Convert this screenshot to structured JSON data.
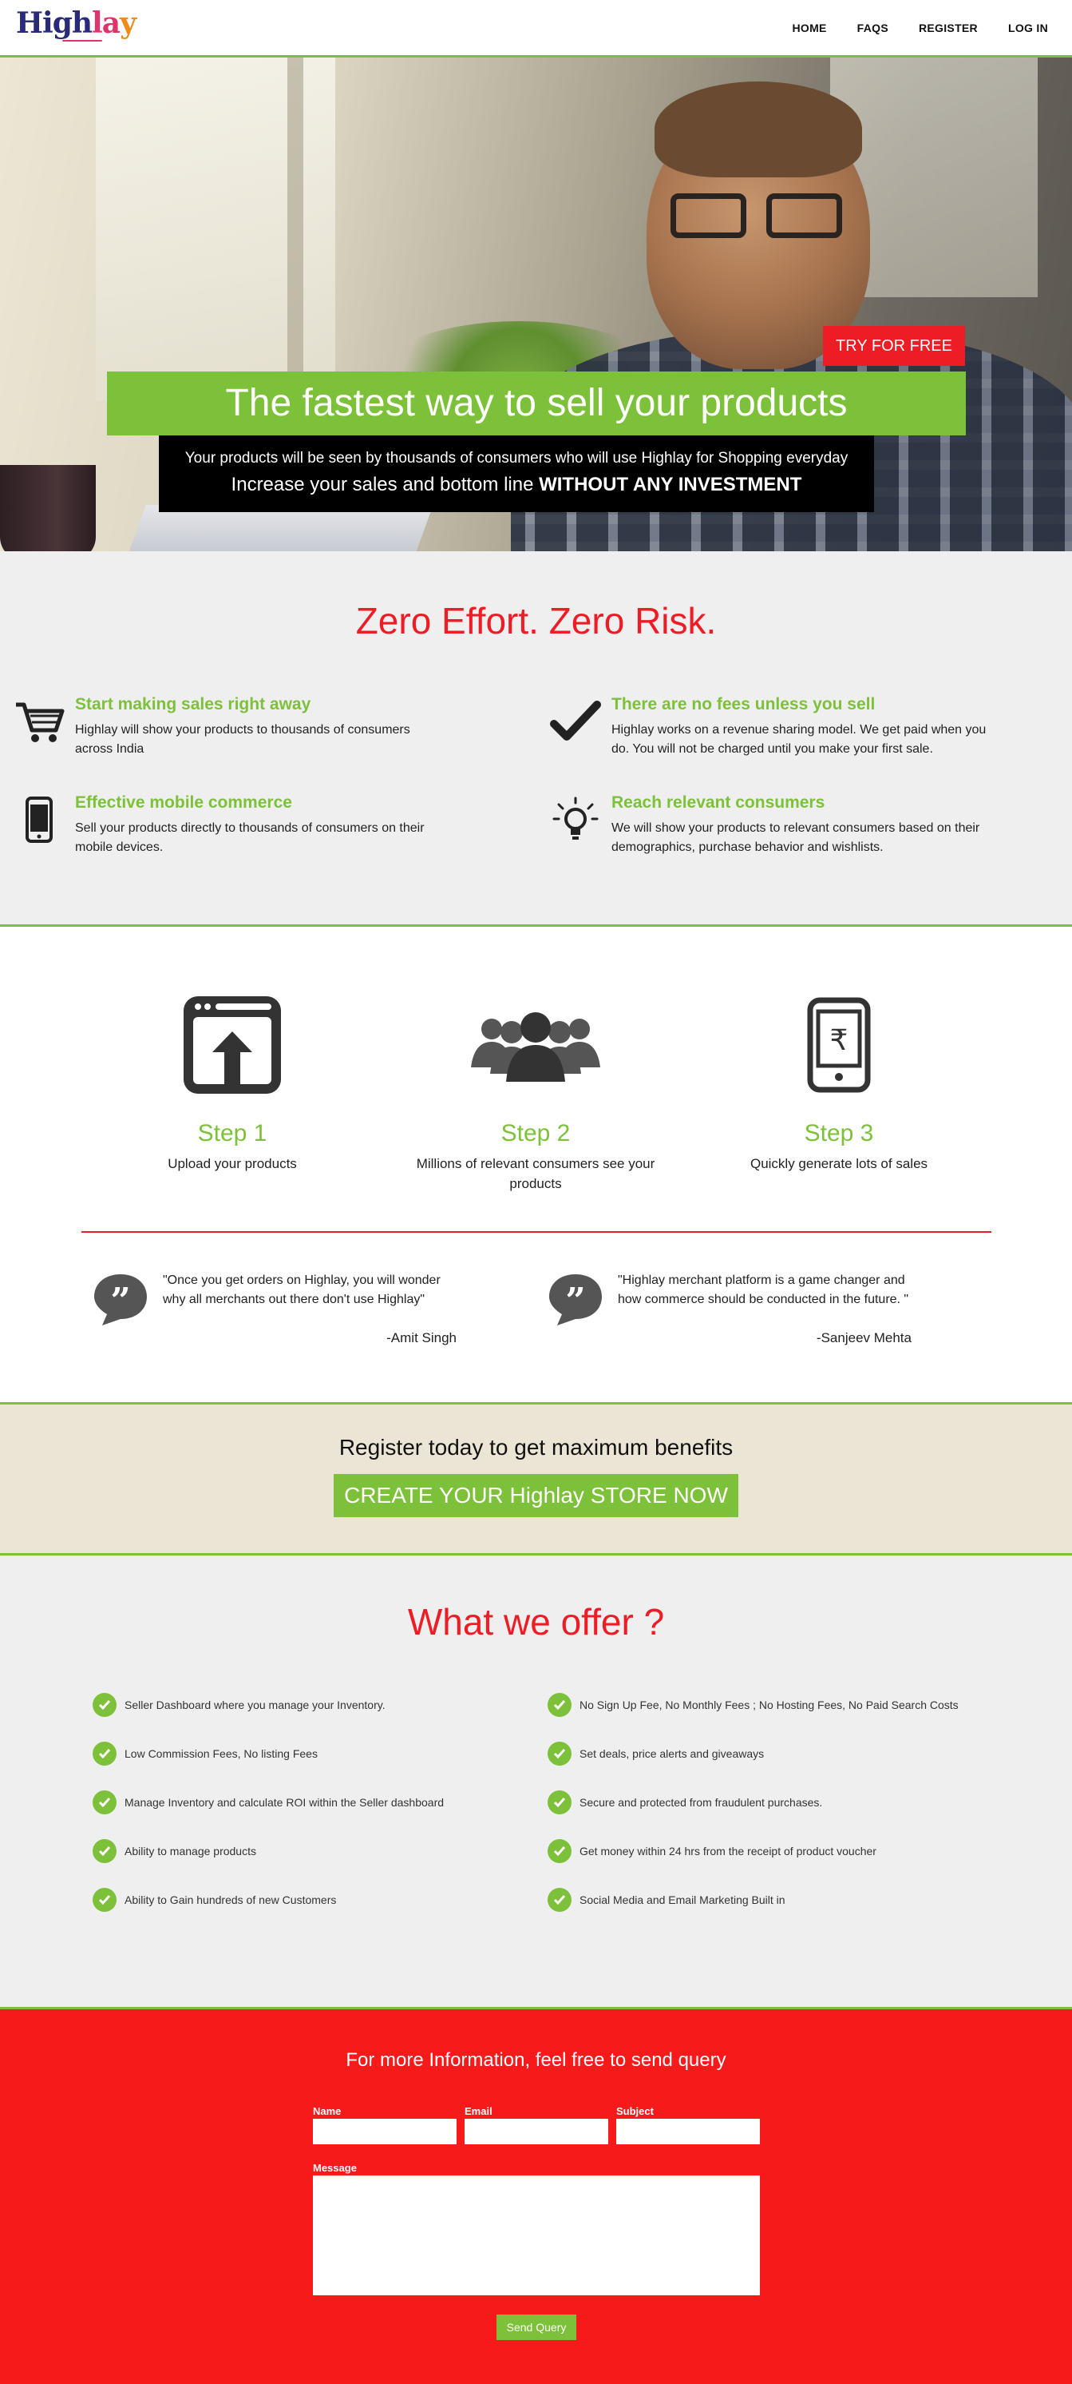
{
  "nav": {
    "logo_part1": "High",
    "logo_part2": "la",
    "logo_part3": "y",
    "items": [
      {
        "label": "HOME"
      },
      {
        "label": "FAQS"
      },
      {
        "label": "REGISTER"
      },
      {
        "label": "LOG IN"
      }
    ]
  },
  "hero": {
    "try_button": "TRY FOR FREE",
    "headline": "The fastest way to sell your products",
    "sub1": "Your products will be seen by thousands of consumers who will use Highlay for Shopping everyday",
    "sub2_prefix": "Increase your sales and bottom line ",
    "sub2_bold": "WITHOUT ANY INVESTMENT"
  },
  "zero": {
    "title": "Zero Effort. Zero Risk.",
    "features": [
      {
        "icon": "cart-icon",
        "title": "Start making sales right away",
        "text": "Highlay will show your products to thousands of consumers across India"
      },
      {
        "icon": "checkmark-icon",
        "title": "There are no fees unless you sell",
        "text": "Highlay works on a revenue sharing model. We get paid when you do. You will not be charged until you make your first sale."
      },
      {
        "icon": "mobile-icon",
        "title": "Effective mobile commerce",
        "text": "Sell your products directly to thousands of consumers on their mobile devices."
      },
      {
        "icon": "lightbulb-icon",
        "title": "Reach relevant consumers",
        "text": "We will show your products to relevant consumers based on their demographics, purchase behavior and wishlists."
      }
    ]
  },
  "steps": [
    {
      "icon": "upload-icon",
      "title": "Step 1",
      "text": "Upload your products"
    },
    {
      "icon": "people-icon",
      "title": "Step 2",
      "text": "Millions of relevant consumers see your products"
    },
    {
      "icon": "rupee-phone-icon",
      "title": "Step 3",
      "text": "Quickly generate lots of sales"
    }
  ],
  "quotes": [
    {
      "text": "\"Once you get orders on Highlay, you will wonder why all merchants out there don't use Highlay\"",
      "author": "-Amit Singh"
    },
    {
      "text": "\"Highlay merchant platform is a game changer and how commerce should be conducted in the future. \"",
      "author": "-Sanjeev Mehta"
    }
  ],
  "register": {
    "title": "Register today to get maximum benefits",
    "button": "CREATE YOUR Highlay STORE NOW"
  },
  "offer": {
    "title": "What we offer ?",
    "left": [
      "Seller Dashboard where you manage your Inventory.",
      "Low Commission Fees, No listing Fees",
      "Manage Inventory and calculate ROI within the Seller dashboard",
      "Ability to manage products",
      "Ability to Gain hundreds of new Customers"
    ],
    "right": [
      "No Sign Up Fee, No Monthly Fees ; No Hosting Fees, No Paid Search Costs",
      "Set deals, price alerts and giveaways",
      "Secure and protected from fraudulent purchases.",
      "Get money within 24 hrs from the receipt of product voucher",
      "Social Media and Email Marketing Built in"
    ]
  },
  "contact": {
    "title": "For more Information, feel free to send query",
    "name_label": "Name",
    "email_label": "Email",
    "subject_label": "Subject",
    "message_label": "Message",
    "name_value": "",
    "email_value": "",
    "subject_value": "",
    "message_value": "",
    "send_button": "Send Query"
  },
  "colors": {
    "green": "#7dc13a",
    "red": "#ee1c25",
    "contact_red": "#f71a1a",
    "band": "#ebe5d5"
  }
}
